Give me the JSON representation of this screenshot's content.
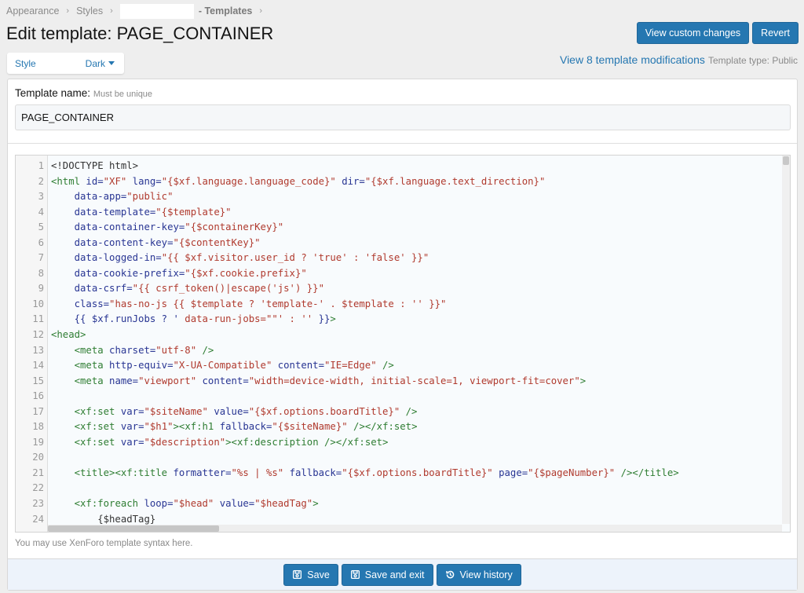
{
  "breadcrumb": {
    "items": [
      "Appearance",
      "Styles"
    ],
    "current": "- Templates"
  },
  "page_title": "Edit template: PAGE_CONTAINER",
  "actions": {
    "view_custom_changes": "View custom changes",
    "revert": "Revert"
  },
  "style_chooser": {
    "label": "Style",
    "value": "Dark"
  },
  "modifications": {
    "link": "View 8 template modifications",
    "type": "Template type: Public"
  },
  "form": {
    "name_label": "Template name:",
    "name_hint": "Must be unique",
    "name_value": "PAGE_CONTAINER",
    "editor_hint": "You may use XenForo template syntax here."
  },
  "code_lines": [
    [
      [
        "p",
        "<!DOCTYPE html>"
      ]
    ],
    [
      [
        "t",
        "<html "
      ],
      [
        "a",
        "id="
      ],
      [
        "s",
        "\"XF\" "
      ],
      [
        "a",
        "lang="
      ],
      [
        "s",
        "\"{$xf.language.language_code}\" "
      ],
      [
        "a",
        "dir="
      ],
      [
        "s",
        "\"{$xf.language.text_direction}\""
      ]
    ],
    [
      [
        "p",
        "    "
      ],
      [
        "a",
        "data-app="
      ],
      [
        "s",
        "\"public\""
      ]
    ],
    [
      [
        "p",
        "    "
      ],
      [
        "a",
        "data-template="
      ],
      [
        "s",
        "\"{$template}\""
      ]
    ],
    [
      [
        "p",
        "    "
      ],
      [
        "a",
        "data-container-key="
      ],
      [
        "s",
        "\"{$containerKey}\""
      ]
    ],
    [
      [
        "p",
        "    "
      ],
      [
        "a",
        "data-content-key="
      ],
      [
        "s",
        "\"{$contentKey}\""
      ]
    ],
    [
      [
        "p",
        "    "
      ],
      [
        "a",
        "data-logged-in="
      ],
      [
        "s",
        "\"{{ $xf.visitor.user_id ? 'true' : 'false' }}\""
      ]
    ],
    [
      [
        "p",
        "    "
      ],
      [
        "a",
        "data-cookie-prefix="
      ],
      [
        "s",
        "\"{$xf.cookie.prefix}\""
      ]
    ],
    [
      [
        "p",
        "    "
      ],
      [
        "a",
        "data-csrf="
      ],
      [
        "s",
        "\"{{ csrf_token()|escape('js') }}\""
      ]
    ],
    [
      [
        "p",
        "    "
      ],
      [
        "a",
        "class="
      ],
      [
        "s",
        "\"has-no-js {{ $template ? 'template-' . $template : '' }}\""
      ]
    ],
    [
      [
        "p",
        "    "
      ],
      [
        "a",
        "{{ $xf.runJobs ? ' "
      ],
      [
        "s",
        "data-run-jobs=\"\"' : '' "
      ],
      [
        "a",
        "}}"
      ],
      [
        "t",
        ">"
      ]
    ],
    [
      [
        "t",
        "<head>"
      ]
    ],
    [
      [
        "p",
        "    "
      ],
      [
        "t",
        "<meta "
      ],
      [
        "a",
        "charset="
      ],
      [
        "s",
        "\"utf-8\" "
      ],
      [
        "t",
        "/>"
      ]
    ],
    [
      [
        "p",
        "    "
      ],
      [
        "t",
        "<meta "
      ],
      [
        "a",
        "http-equiv="
      ],
      [
        "s",
        "\"X-UA-Compatible\" "
      ],
      [
        "a",
        "content="
      ],
      [
        "s",
        "\"IE=Edge\" "
      ],
      [
        "t",
        "/>"
      ]
    ],
    [
      [
        "p",
        "    "
      ],
      [
        "t",
        "<meta "
      ],
      [
        "a",
        "name="
      ],
      [
        "s",
        "\"viewport\" "
      ],
      [
        "a",
        "content="
      ],
      [
        "s",
        "\"width=device-width, initial-scale=1, viewport-fit=cover\""
      ],
      [
        "t",
        ">"
      ]
    ],
    [
      [
        "p",
        ""
      ]
    ],
    [
      [
        "p",
        "    "
      ],
      [
        "t",
        "<xf:set "
      ],
      [
        "a",
        "var="
      ],
      [
        "s",
        "\"$siteName\" "
      ],
      [
        "a",
        "value="
      ],
      [
        "s",
        "\"{$xf.options.boardTitle}\" "
      ],
      [
        "t",
        "/>"
      ]
    ],
    [
      [
        "p",
        "    "
      ],
      [
        "t",
        "<xf:set "
      ],
      [
        "a",
        "var="
      ],
      [
        "s",
        "\"$h1\""
      ],
      [
        "t",
        "><xf:h1 "
      ],
      [
        "a",
        "fallback="
      ],
      [
        "s",
        "\"{$siteName}\" "
      ],
      [
        "t",
        "/></xf:set>"
      ]
    ],
    [
      [
        "p",
        "    "
      ],
      [
        "t",
        "<xf:set "
      ],
      [
        "a",
        "var="
      ],
      [
        "s",
        "\"$description\""
      ],
      [
        "t",
        "><xf:description /></xf:set>"
      ]
    ],
    [
      [
        "p",
        ""
      ]
    ],
    [
      [
        "p",
        "    "
      ],
      [
        "t",
        "<title><xf:title "
      ],
      [
        "a",
        "formatter="
      ],
      [
        "s",
        "\"%s | %s\" "
      ],
      [
        "a",
        "fallback="
      ],
      [
        "s",
        "\"{$xf.options.boardTitle}\" "
      ],
      [
        "a",
        "page="
      ],
      [
        "s",
        "\"{$pageNumber}\" "
      ],
      [
        "t",
        "/></title>"
      ]
    ],
    [
      [
        "p",
        ""
      ]
    ],
    [
      [
        "p",
        "    "
      ],
      [
        "t",
        "<xf:foreach "
      ],
      [
        "a",
        "loop="
      ],
      [
        "s",
        "\"$head\" "
      ],
      [
        "a",
        "value="
      ],
      [
        "s",
        "\"$headTag\""
      ],
      [
        "t",
        ">"
      ]
    ],
    [
      [
        "p",
        "        {$headTag}"
      ]
    ]
  ],
  "footer": {
    "save": "Save",
    "save_exit": "Save and exit",
    "history": "View history"
  }
}
